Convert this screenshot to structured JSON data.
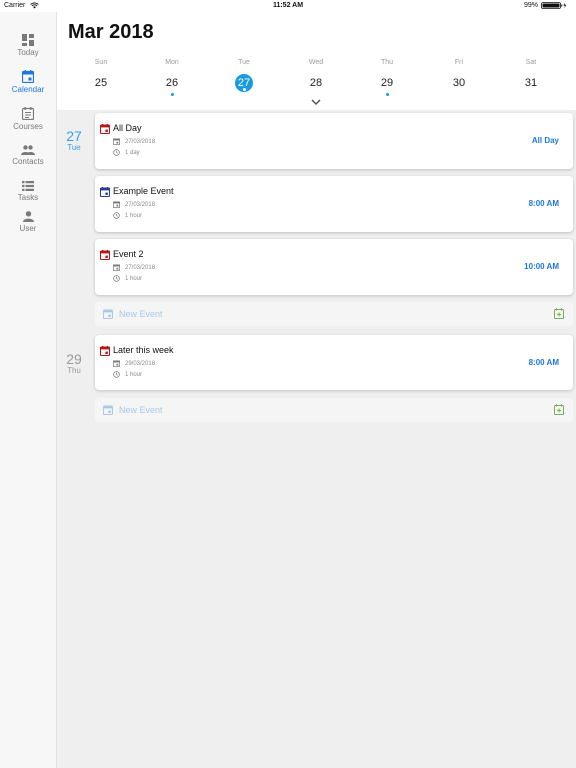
{
  "status_bar": {
    "carrier": "Carrier",
    "time": "11:52 AM",
    "battery": "99%"
  },
  "sidebar": {
    "items": [
      {
        "label": "Today",
        "icon": "dashboard-icon",
        "active": false
      },
      {
        "label": "Calendar",
        "icon": "calendar-icon",
        "active": true
      },
      {
        "label": "Courses",
        "icon": "courses-icon",
        "active": false
      },
      {
        "label": "Contacts",
        "icon": "contacts-icon",
        "active": false
      },
      {
        "label": "Tasks",
        "icon": "tasks-icon",
        "active": false
      },
      {
        "label": "User",
        "icon": "user-icon",
        "active": false
      }
    ]
  },
  "header": {
    "title": "Mar 2018"
  },
  "week": {
    "days": [
      {
        "name": "Sun",
        "num": "25"
      },
      {
        "name": "Mon",
        "num": "26",
        "has_events": true
      },
      {
        "name": "Tue",
        "num": "27",
        "selected": true,
        "has_events": true
      },
      {
        "name": "Wed",
        "num": "28"
      },
      {
        "name": "Thu",
        "num": "29",
        "has_events": true
      },
      {
        "name": "Fri",
        "num": "30"
      },
      {
        "name": "Sat",
        "num": "31"
      }
    ]
  },
  "agenda": {
    "groups": [
      {
        "day_num": "27",
        "day_name": "Tue",
        "events": [
          {
            "title": "All Day",
            "date": "27/03/2018",
            "duration": "1 day",
            "time": "All Day",
            "icon_color": "#b3171b"
          },
          {
            "title": "Example Event",
            "date": "27/03/2018",
            "duration": "1 hour",
            "time": "8:00 AM",
            "icon_color": "#233e8b"
          },
          {
            "title": "Event 2",
            "date": "27/03/2018",
            "duration": "1 hour",
            "time": "10:00 AM",
            "icon_color": "#b3171b"
          }
        ],
        "new_event_label": "New Event"
      },
      {
        "day_num": "29",
        "day_name": "Thu",
        "events": [
          {
            "title": "Later this week",
            "date": "29/03/2018",
            "duration": "1 hour",
            "time": "8:00 AM",
            "icon_color": "#b3171b"
          }
        ],
        "new_event_label": "New Event"
      }
    ]
  },
  "colors": {
    "accent": "#1e77e0",
    "selected_day": "#1a9be0",
    "add_icon": "#7cae5a",
    "new_event_text": "#a8c8ec"
  }
}
